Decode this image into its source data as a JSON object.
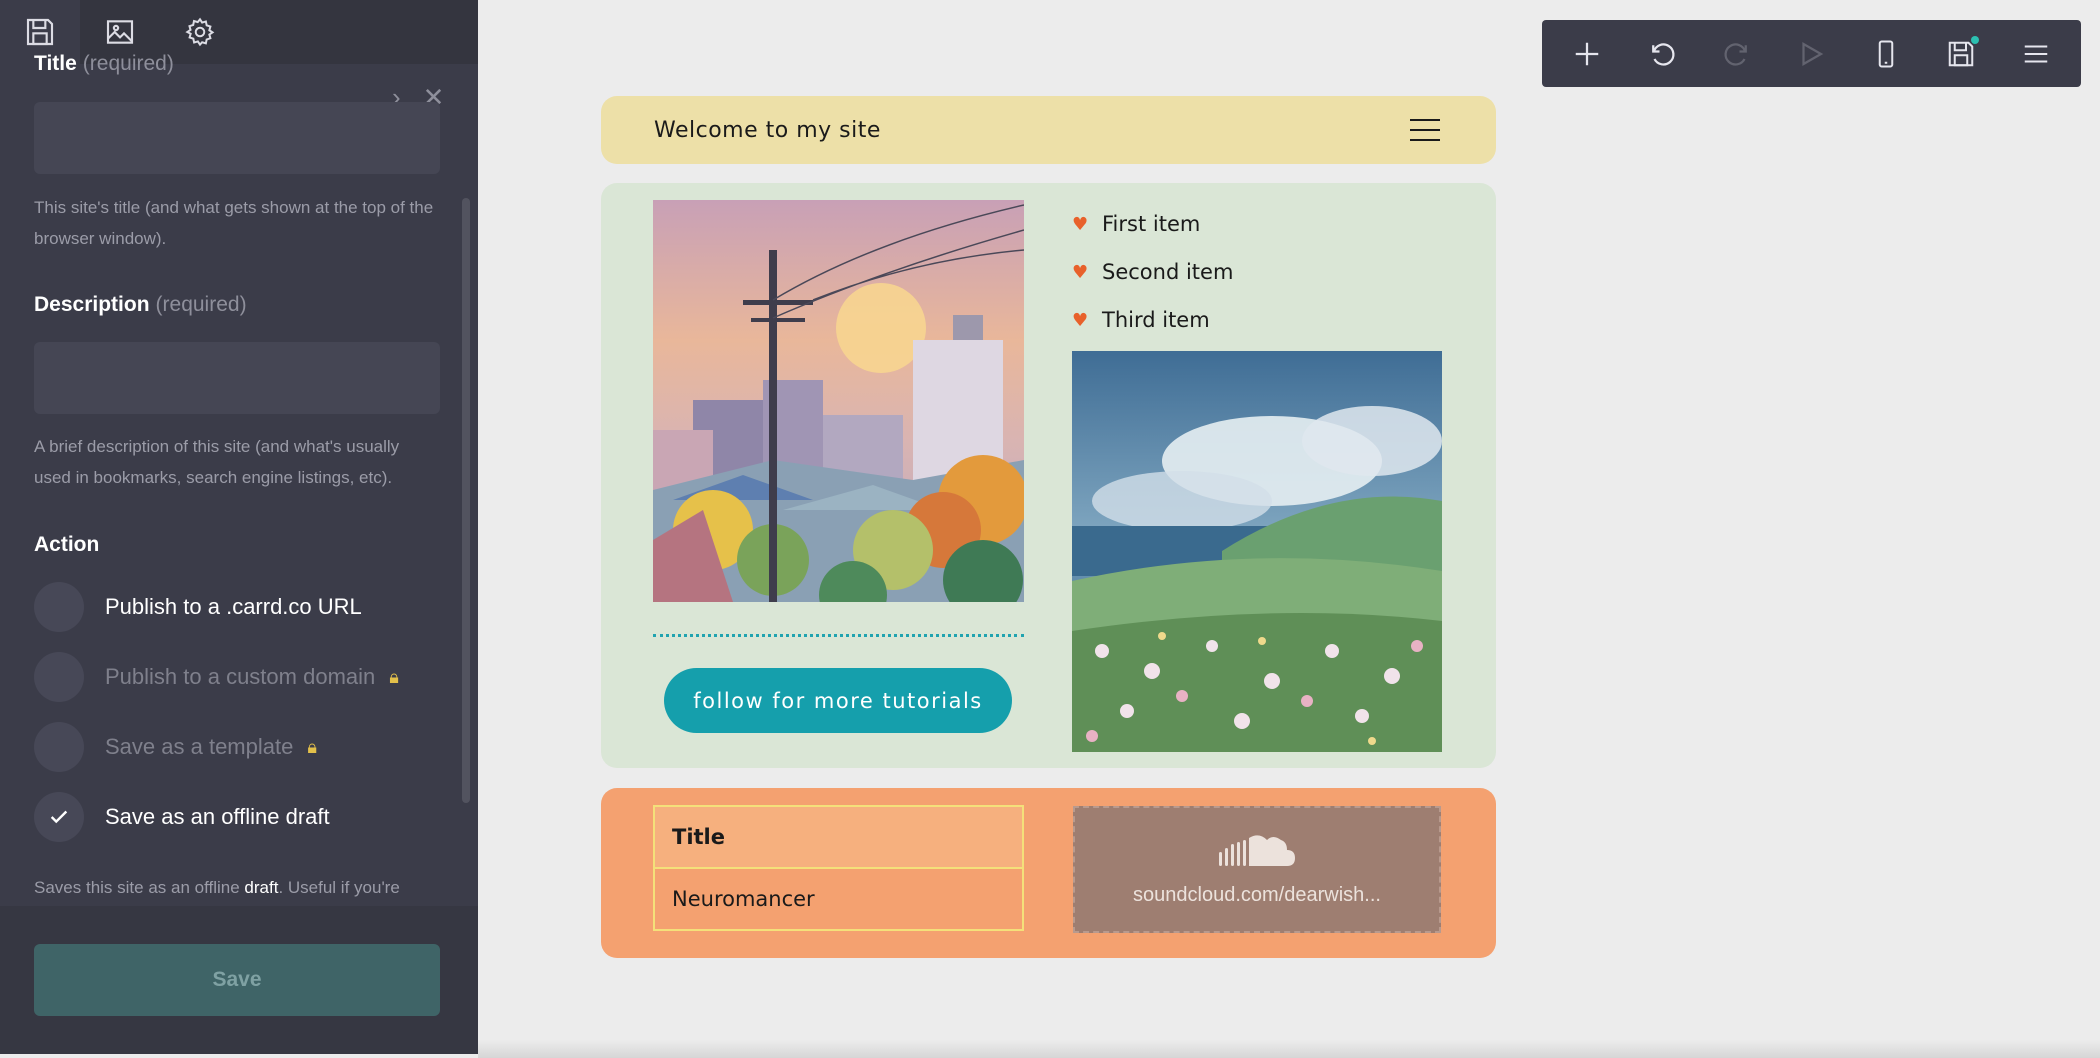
{
  "sidebar": {
    "tabs": [
      {
        "icon": "save-icon"
      },
      {
        "icon": "image-icon"
      },
      {
        "icon": "settings-icon"
      }
    ],
    "title_label": "Title",
    "title_req": "(required)",
    "title_value": "",
    "title_help": "This site's title (and what gets shown at the top of the browser window).",
    "desc_label": "Description",
    "desc_req": "(required)",
    "desc_value": "",
    "desc_help": "A brief description of this site (and what's usually used in bookmarks, search engine listings, etc).",
    "action_label": "Action",
    "options": [
      {
        "label": "Publish to a .carrd.co URL",
        "locked": false,
        "selected": false
      },
      {
        "label": "Publish to a custom domain",
        "locked": true,
        "selected": false
      },
      {
        "label": "Save as a template",
        "locked": true,
        "selected": false
      },
      {
        "label": "Save as an offline draft",
        "locked": false,
        "selected": true
      }
    ],
    "draft_help_prefix": "Saves this site as an offline ",
    "draft_help_bold": "draft",
    "draft_help_suffix": ". Useful if you're",
    "save_label": "Save"
  },
  "toolbar": {
    "buttons": [
      "add-icon",
      "undo-icon",
      "redo-icon",
      "play-icon",
      "mobile-icon",
      "save-icon",
      "menu-icon"
    ]
  },
  "site": {
    "header_title": "Welcome to my site",
    "list_items": [
      "First item",
      "Second item",
      "Third item"
    ],
    "follow_label": "follow for more tutorials",
    "table_header": "Title",
    "table_value": "Neuromancer",
    "soundcloud_url": "soundcloud.com/dearwish..."
  },
  "colors": {
    "accent": "#159fac",
    "header_bg": "#ede0a8",
    "section_bg": "#dae6d6",
    "footer_bg": "#f4a170",
    "heart": "#e8612b"
  }
}
